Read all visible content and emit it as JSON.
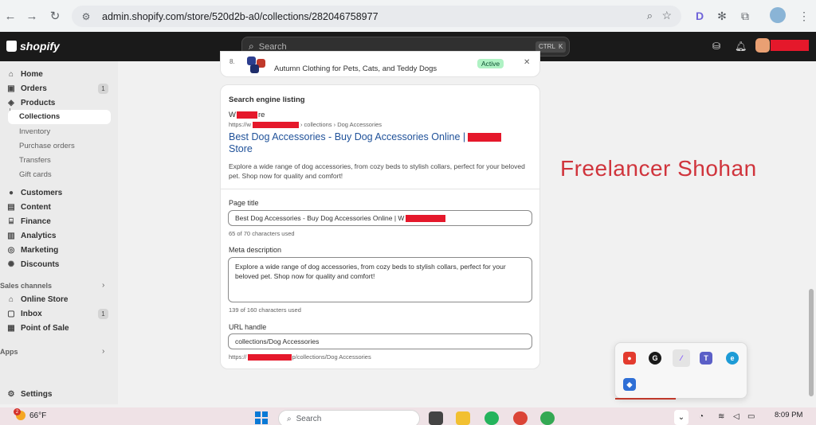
{
  "browser": {
    "url": "admin.shopify.com/store/520d2b-a0/collections/282046758977",
    "profile_initial": "D"
  },
  "topbar": {
    "logo_text": "shopify",
    "search_placeholder": "Search",
    "kbd_ctrl": "CTRL",
    "kbd_k": "K"
  },
  "sidebar": {
    "home": "Home",
    "orders": "Orders",
    "orders_count": "1",
    "products": "Products",
    "collections": "Collections",
    "inventory": "Inventory",
    "purchase_orders": "Purchase orders",
    "transfers": "Transfers",
    "gift_cards": "Gift cards",
    "customers": "Customers",
    "content": "Content",
    "finance": "Finance",
    "analytics": "Analytics",
    "marketing": "Marketing",
    "discounts": "Discounts",
    "sales_channels": "Sales channels",
    "online_store": "Online Store",
    "inbox": "Inbox",
    "inbox_count": "1",
    "point_of_sale": "Point of Sale",
    "apps": "Apps",
    "settings": "Settings"
  },
  "product_row": {
    "index": "8.",
    "name": "Autumn Clothing for Pets, Cats, and Teddy Dogs",
    "status": "Active"
  },
  "seo": {
    "heading": "Search engine listing",
    "store_name_prefix": "W",
    "store_name_suffix": "re",
    "breadcrumb_prefix": "https://w",
    "breadcrumb_suffix": "› collections › Dog Accessories",
    "title_text": "Best Dog Accessories - Buy Dog Accessories Online |",
    "title_store": "Store",
    "description": "Explore a wide range of dog accessories, from cozy beds to stylish collars, perfect for your beloved pet. Shop now for quality and comfort!",
    "page_title_label": "Page title",
    "page_title_value": "Best Dog Accessories - Buy Dog Accessories Online | W",
    "page_title_help": "65 of 70 characters used",
    "meta_label": "Meta description",
    "meta_value": "Explore a wide range of dog accessories, from cozy beds to stylish collars, perfect for your beloved pet. Shop now for quality and comfort!",
    "meta_help": "139 of 160 characters used",
    "url_label": "URL handle",
    "url_value": "collections/Dog Accessories",
    "url_help_prefix": "https://",
    "url_help_suffix": "p/collections/Dog Accessories"
  },
  "watermark": "Freelancer Shohan",
  "taskbar": {
    "temperature": "66°F",
    "weather_badge": "2",
    "search": "Search",
    "time": "8:09 PM"
  }
}
